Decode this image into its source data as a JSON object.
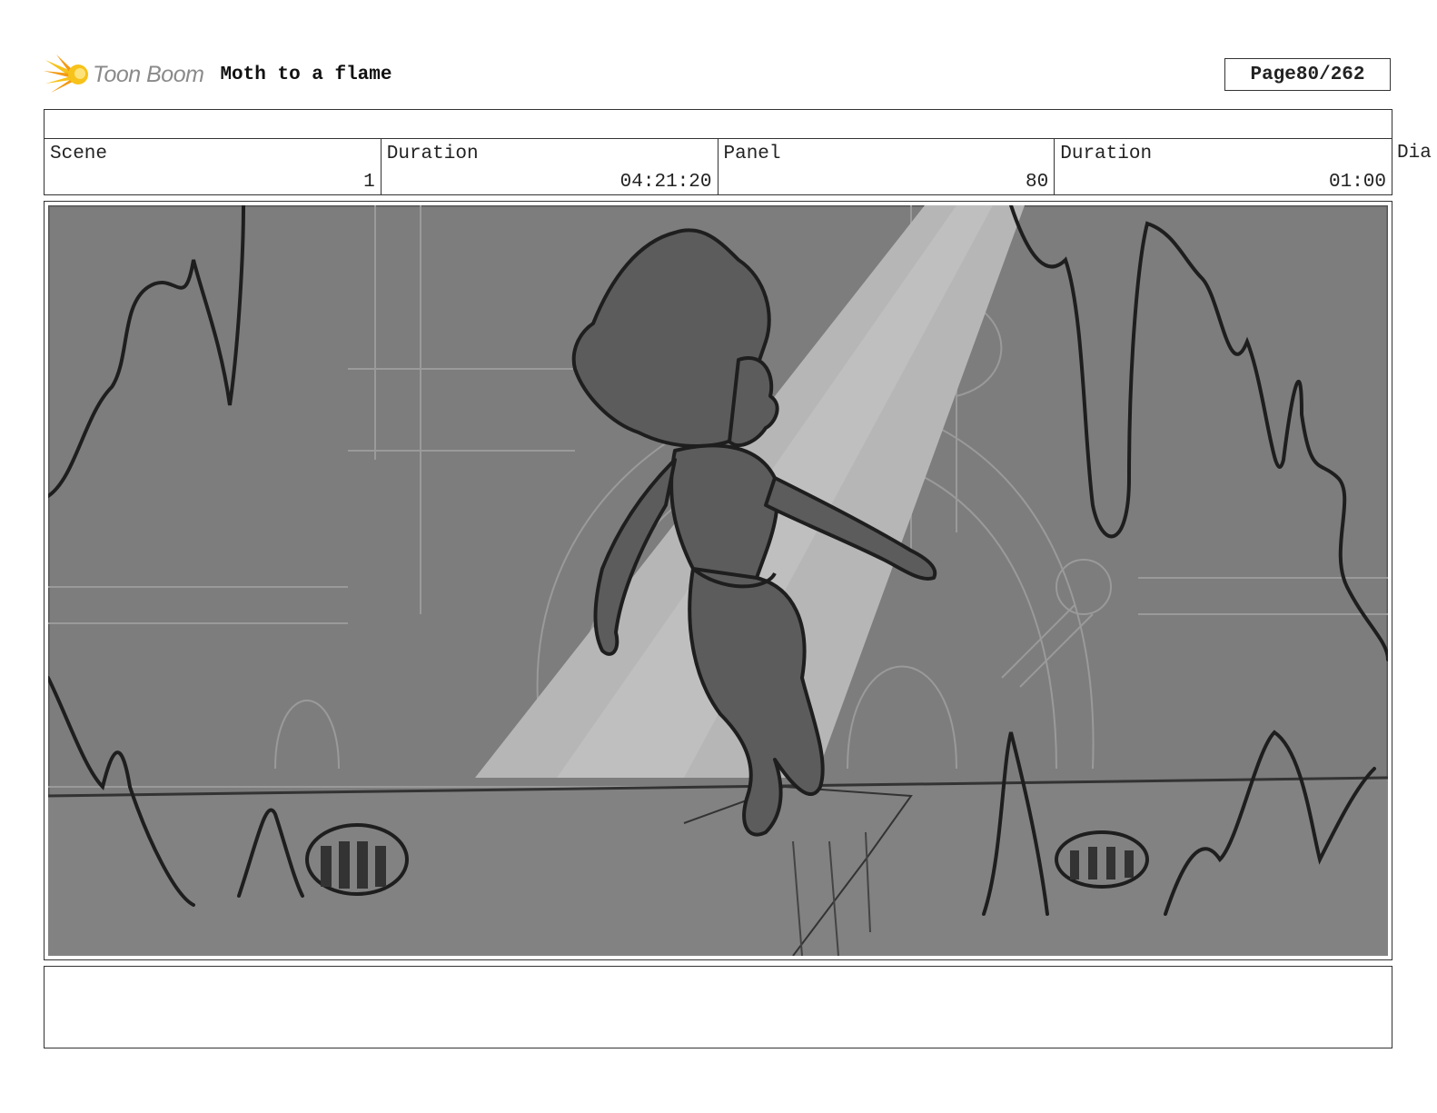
{
  "header": {
    "logo_text": "Toon Boom",
    "title": "Moth to a flame",
    "page_label": "Page",
    "page_value": "80/262"
  },
  "info": {
    "scene_label": "Scene",
    "scene_value": "1",
    "scene_duration_label": "Duration",
    "scene_duration_value": "04:21:20",
    "panel_label": "Panel",
    "panel_value": "80",
    "panel_duration_label": "Duration",
    "panel_duration_value": "01:00",
    "overflow_label": "Dia"
  },
  "colors": {
    "logo_yellow": "#f7c21a",
    "logo_orange": "#f39a12",
    "sketch_bg": "#7d7d7d",
    "light_beam": "#b6b6b6",
    "character_fill": "#5c5c5c",
    "ink": "#1e1e1e"
  },
  "panel": {
    "icon": "storyboard-sketch-image"
  }
}
